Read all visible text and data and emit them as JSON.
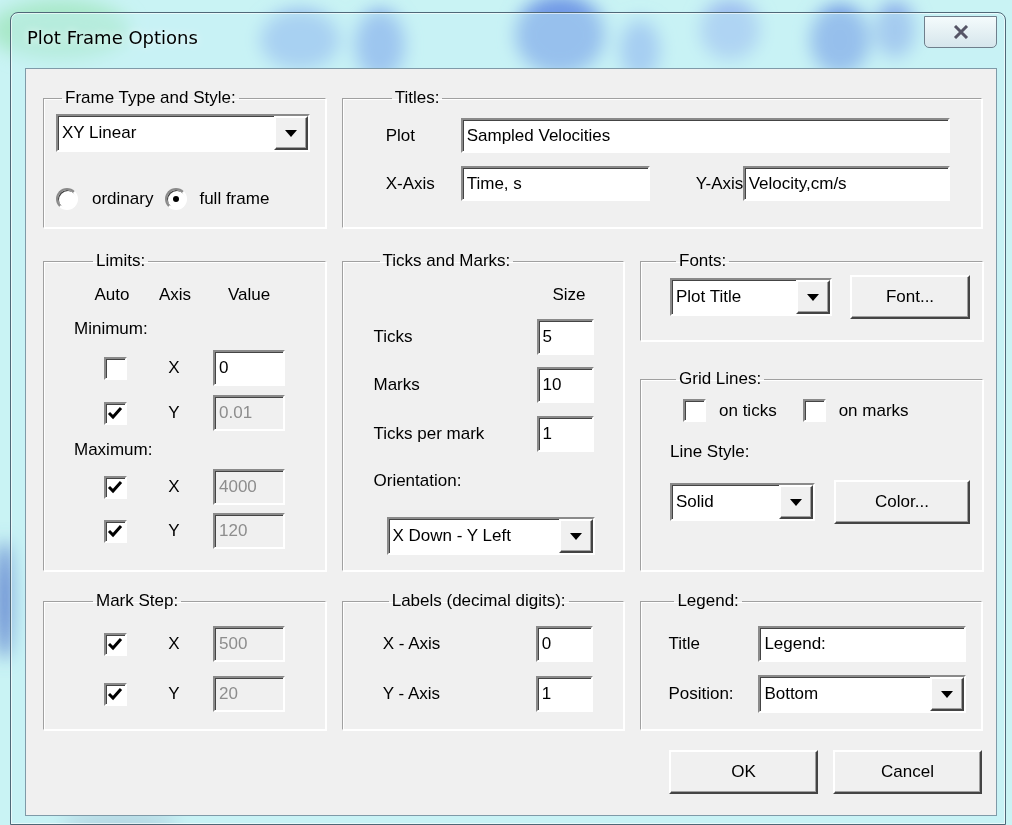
{
  "window": {
    "title": "Plot Frame Options"
  },
  "frame_type": {
    "label": "Frame Type and Style:",
    "dropdown": {
      "value": "XY Linear"
    },
    "radios": [
      {
        "label": "ordinary",
        "selected": false
      },
      {
        "label": "full frame",
        "selected": true
      }
    ]
  },
  "titles": {
    "label": "Titles:",
    "fields": [
      {
        "label": "Plot",
        "value": "Sampled Velocities"
      },
      {
        "label": "X-Axis",
        "value": "Time, s"
      },
      {
        "label": "Y-Axis",
        "value": "Velocity,cm/s"
      }
    ]
  },
  "limits": {
    "label": "Limits:",
    "headers": [
      "Auto",
      "Axis",
      "Value"
    ],
    "sections": [
      {
        "label": "Minimum:",
        "rows": [
          {
            "checked": false,
            "axis": "X",
            "value": "0",
            "disabled": false
          },
          {
            "checked": true,
            "axis": "Y",
            "value": "0.01",
            "disabled": true
          }
        ]
      },
      {
        "label": "Maximum:",
        "rows": [
          {
            "checked": true,
            "axis": "X",
            "value": "4000",
            "disabled": true
          },
          {
            "checked": true,
            "axis": "Y",
            "value": "120",
            "disabled": true
          }
        ]
      }
    ]
  },
  "ticks_and_marks": {
    "label": "Ticks and Marks:",
    "size_header": "Size",
    "rows": [
      {
        "label": "Ticks",
        "value": "5"
      },
      {
        "label": "Marks",
        "value": "10"
      },
      {
        "label": "Ticks per mark",
        "value": "1"
      }
    ],
    "orientation_label": "Orientation:",
    "orientation": {
      "value": "X Down - Y Left"
    }
  },
  "fonts": {
    "label": "Fonts:",
    "dropdown": {
      "value": "Plot Title"
    },
    "button": "Font..."
  },
  "grid_lines": {
    "label": "Grid Lines:",
    "checks": [
      {
        "label": "on ticks",
        "checked": false
      },
      {
        "label": "on marks",
        "checked": false
      }
    ],
    "line_style_label": "Line Style:",
    "dropdown": {
      "value": "Solid"
    },
    "button": "Color..."
  },
  "mark_step": {
    "label": "Mark Step:",
    "rows": [
      {
        "checked": true,
        "axis": "X",
        "value": "500",
        "disabled": true
      },
      {
        "checked": true,
        "axis": "Y",
        "value": "20",
        "disabled": true
      }
    ]
  },
  "labels": {
    "label": "Labels (decimal digits):",
    "rows": [
      {
        "label": "X - Axis",
        "value": "0"
      },
      {
        "label": "Y - Axis",
        "value": "1"
      }
    ]
  },
  "legend": {
    "label": "Legend:",
    "title_label": "Title",
    "title_value": "Legend:",
    "position_label": "Position:",
    "position": {
      "value": "Bottom"
    }
  },
  "buttons": [
    "OK",
    "Cancel"
  ]
}
